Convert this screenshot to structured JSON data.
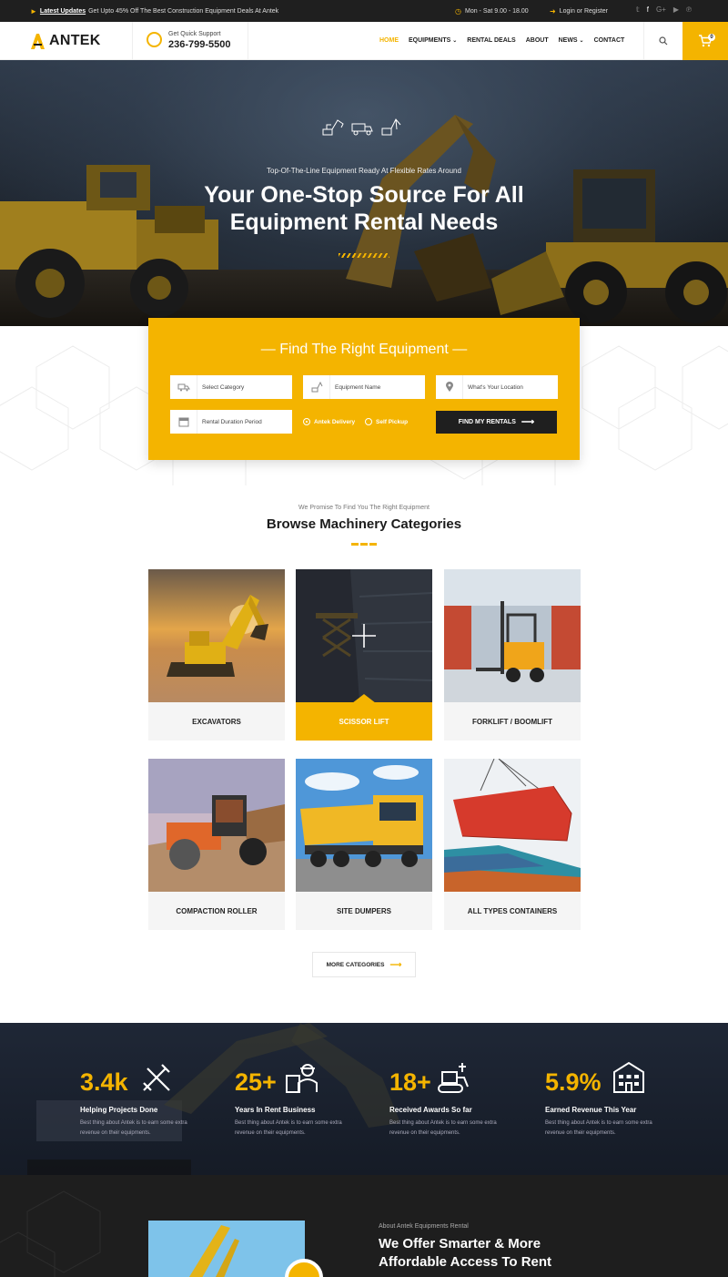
{
  "topbar": {
    "promo_strong": "Latest Updates",
    "promo_text": "Get Upto 45% Off The Best Construction Equipment Deals At Antek",
    "hours": "Mon - Sat 9.00 - 18.00",
    "login": "Login or Register",
    "social": [
      {
        "name": "twitter-icon",
        "glyph": "𝕥"
      },
      {
        "name": "facebook-icon",
        "glyph": "f"
      },
      {
        "name": "google-plus-icon",
        "glyph": "G+"
      },
      {
        "name": "youtube-icon",
        "glyph": "▶"
      },
      {
        "name": "pinterest-icon",
        "glyph": "℗"
      }
    ]
  },
  "header": {
    "logo": "ANTEK",
    "support_label": "Get Quick Support",
    "support_phone": "236-799-5500",
    "nav": [
      "HOME",
      "EQUIPMENTS",
      "RENTAL DEALS",
      "ABOUT",
      "NEWS",
      "CONTACT"
    ],
    "cart_count": "0"
  },
  "hero": {
    "subtitle": "Top-Of-The-Line Equipment Ready At Flexible Rates Around",
    "title_line1": "Your One-Stop Source For All",
    "title_line2": "Equipment Rental Needs"
  },
  "finder": {
    "title": "Find The Right Equipment",
    "category_placeholder": "Select Category",
    "equipment_placeholder": "Equipment Name",
    "location_placeholder": "What's Your Location",
    "duration_placeholder": "Rental Duration Period",
    "option_delivery": "Antek Delivery",
    "option_pickup": "Self Pickup",
    "button": "FIND MY RENTALS"
  },
  "categories": {
    "subtitle": "We Promise To Find You The Right Equipment",
    "title": "Browse Machinery Categories",
    "items": [
      "EXCAVATORS",
      "SCISSOR LIFT",
      "FORKLIFT / BOOMLIFT",
      "COMPACTION ROLLER",
      "SITE DUMPERS",
      "ALL TYPES CONTAINERS"
    ],
    "more": "MORE CATEGORIES"
  },
  "stats": [
    {
      "num": "3.4k",
      "label": "Helping Projects Done",
      "desc": "Best thing about Antek is to earn some extra revenue on their equipments."
    },
    {
      "num": "25+",
      "label": "Years In Rent Business",
      "desc": "Best thing about Antek is to earn some extra revenue on their equipments."
    },
    {
      "num": "18+",
      "label": "Received Awards So far",
      "desc": "Best thing about Antek is to earn some extra revenue on their equipments."
    },
    {
      "num": "5.9%",
      "label": "Earned Revenue This Year",
      "desc": "Best thing about Antek is to earn some extra revenue on their equipments."
    }
  ],
  "about": {
    "subtitle": "About Antek Equipments Rental",
    "title_line1": "We Offer Smarter & More",
    "title_line2": "Affordable Access To Rent"
  },
  "colors": {
    "accent": "#f4b400",
    "dark": "#1f1f1f",
    "navy": "#1f2736"
  }
}
